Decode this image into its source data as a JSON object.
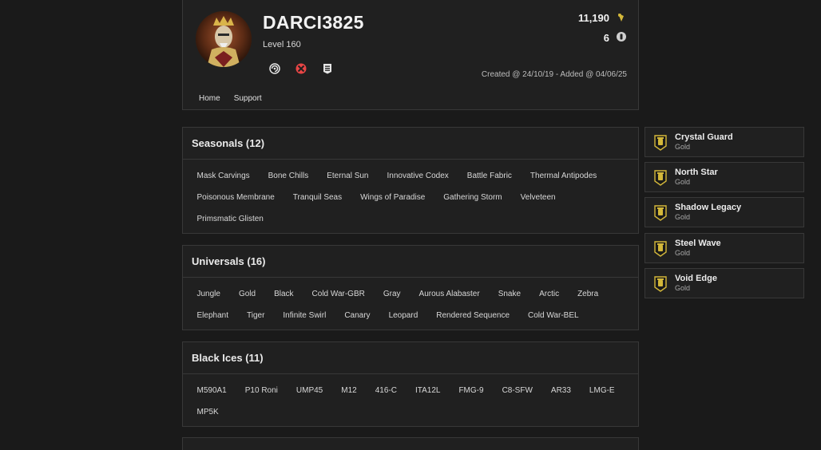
{
  "profile": {
    "username": "DARCI3825",
    "level": "Level 160",
    "credits": "11,190",
    "renown": "6",
    "created": "Created @ 24/10/19 - Added @ 04/06/25",
    "platforms": [
      "ubisoft-icon",
      "xbox-icon",
      "epic-games-icon"
    ]
  },
  "nav": {
    "home": "Home",
    "support": "Support"
  },
  "sections": [
    {
      "title": "Seasonals (12)",
      "items": [
        "Mask Carvings",
        "Bone Chills",
        "Eternal Sun",
        "Innovative Codex",
        "Battle Fabric",
        "Thermal Antipodes",
        "Poisonous Membrane",
        "Tranquil Seas",
        "Wings of Paradise",
        "Gathering Storm",
        "Velveteen",
        "Primsmatic Glisten"
      ]
    },
    {
      "title": "Universals (16)",
      "items": [
        "Jungle",
        "Gold",
        "Black",
        "Cold War-GBR",
        "Gray",
        "Aurous Alabaster",
        "Snake",
        "Arctic",
        "Zebra",
        "Elephant",
        "Tiger",
        "Infinite Swirl",
        "Canary",
        "Leopard",
        "Rendered Sequence",
        "Cold War-BEL"
      ]
    },
    {
      "title": "Black Ices (11)",
      "items": [
        "M590A1",
        "P10 Roni",
        "UMP45",
        "M12",
        "416-C",
        "ITA12L",
        "FMG-9",
        "C8-SFW",
        "AR33",
        "LMG-E",
        "MP5K"
      ]
    }
  ],
  "charms": [
    {
      "name": "Crystal Guard",
      "tier": "Gold"
    },
    {
      "name": "North Star",
      "tier": "Gold"
    },
    {
      "name": "Shadow Legacy",
      "tier": "Gold"
    },
    {
      "name": "Steel Wave",
      "tier": "Gold"
    },
    {
      "name": "Void Edge",
      "tier": "Gold"
    }
  ],
  "colors": {
    "background": "#1a1a1a",
    "card": "#202020",
    "border": "#383838",
    "gold": "#d4b83a",
    "xbox": "#e84545"
  }
}
